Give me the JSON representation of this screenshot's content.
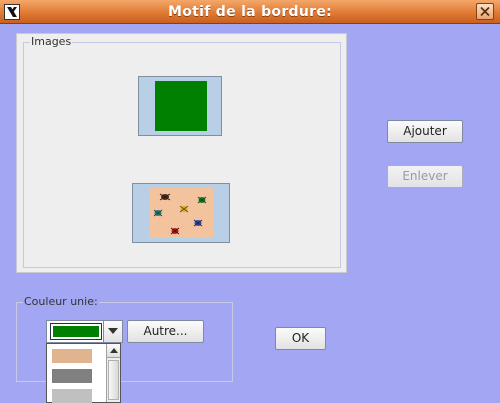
{
  "window": {
    "title": "Motif de la bordure:",
    "icon": "app-icon",
    "close_icon": "close-icon"
  },
  "images_group": {
    "title": "Images",
    "items": [
      {
        "name": "green-pattern",
        "color": "#008000"
      },
      {
        "name": "bugs-pattern",
        "color": "#f2c39c"
      }
    ]
  },
  "buttons": {
    "add": "Ajouter",
    "remove": "Enlever",
    "other": "Autre...",
    "ok": "OK"
  },
  "solid_color": {
    "title": "Couleur unie:",
    "selected_color": "#008000",
    "options": [
      "#e0b48f",
      "#808080",
      "#c0c0c0"
    ]
  },
  "colors": {
    "background": "#a3a6f3",
    "titlebar": "#e07a35",
    "panel": "#eeeeee"
  }
}
